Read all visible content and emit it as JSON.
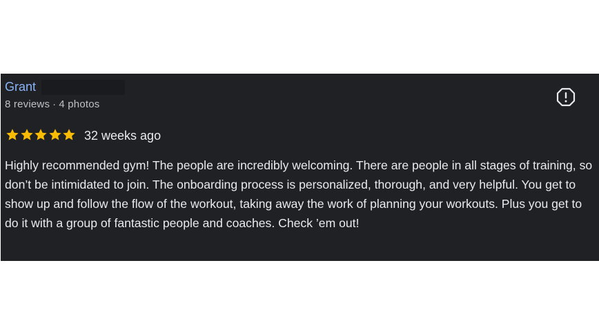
{
  "review": {
    "author_name": "Grant",
    "reviews_count": "8 reviews",
    "separator": "·",
    "photos_count": "4 photos",
    "rating": 5,
    "rating_max": 5,
    "time_ago": "32 weeks ago",
    "text": "Highly recommended gym! The people are incredibly welcoming. There are people in all stages of training, so don’t be intimidated to join. The onboarding process is personalized, thorough, and very helpful. You get to show up and follow the flow of the workout, taking away the work of planning your workouts. Plus you get to do it with a group of fantastic people and coaches. Check ’em out!",
    "report_icon": "report-flag-icon"
  },
  "colors": {
    "card_background": "#202124",
    "author_link": "#8ab4f8",
    "star": "#fbbc04",
    "text_primary": "#e8eaed",
    "text_secondary": "#bdc1c6"
  }
}
